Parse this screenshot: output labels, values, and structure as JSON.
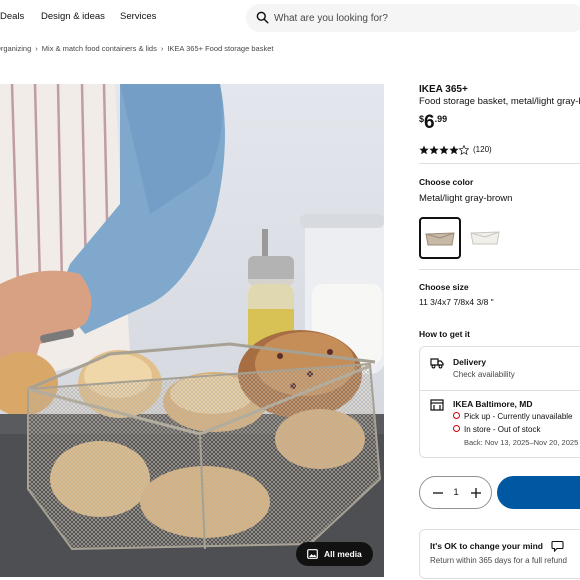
{
  "nav": {
    "items": [
      "Deals",
      "Design & ideas",
      "Services"
    ]
  },
  "search": {
    "placeholder": "What are you looking for?",
    "icon": "search-icon"
  },
  "breadcrumb": [
    "Organizing",
    "Mix & match food containers & lids",
    "IKEA 365+ Food storage basket"
  ],
  "media_button": {
    "label": "All media",
    "icon": "gallery-icon"
  },
  "product": {
    "brand": "IKEA 365+",
    "description": "Food storage basket, metal/light gray-brown",
    "price": {
      "currency": "$",
      "integer": "6",
      "decimal": ".99"
    },
    "rating": {
      "value": 4.5,
      "max": 5,
      "count": "(120)"
    }
  },
  "color": {
    "title": "Choose color",
    "value": "Metal/light gray-brown",
    "options": [
      "metal-light-gray-brown",
      "white"
    ]
  },
  "size": {
    "title": "Choose size",
    "value": "11 3/4x7 7/8x4 3/8 \""
  },
  "get_it": {
    "title": "How to get it",
    "delivery": {
      "title": "Delivery",
      "subtitle": "Check availability"
    },
    "store": {
      "title": "IKEA Baltimore, MD",
      "pickup": "Pick up - Currently unavailable",
      "instore": "In store - Out of stock",
      "back": "Back: Nov 13, 2025–Nov 20, 2025"
    }
  },
  "quantity": {
    "value": "1"
  },
  "colors": {
    "accent": "#0058a3",
    "status_red": "#cc0008"
  },
  "promise": {
    "title": "It's OK to change your mind",
    "text": "Return within 365 days for a full refund"
  }
}
